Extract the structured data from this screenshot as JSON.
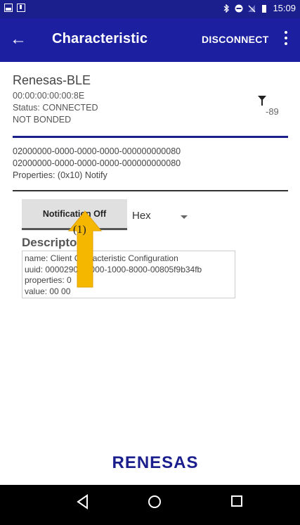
{
  "status_bar": {
    "time": "15:09",
    "icons": [
      "image-icon",
      "download-icon",
      "bluetooth-icon",
      "dnd-icon",
      "no-signal-icon",
      "battery-icon"
    ]
  },
  "app_bar": {
    "back_icon": "arrow-left-icon",
    "title": "Characteristic",
    "disconnect_label": "DISCONNECT",
    "more_icon": "more-vert-icon",
    "color": "#1b1fa0"
  },
  "device": {
    "name": "Renesas-BLE",
    "address": "00:00:00:00:00:8E",
    "status": "Status:  CONNECTED",
    "bond": "NOT BONDED",
    "rssi": "-89",
    "rssi_icon": "antenna-icon"
  },
  "characteristic": {
    "service_uuid": "02000000-0000-0000-0000-000000000080",
    "char_uuid": "02000000-0000-0000-0000-000000000080",
    "properties": "Properties: (0x10) Notify"
  },
  "controls": {
    "notification_label": "Notification Off",
    "format_value": "Hex"
  },
  "descriptors": {
    "title": "Descriptors",
    "name": "name: Client Characteristic Configuration",
    "uuid": "uuid: 00002902-0000-1000-8000-00805f9b34fb",
    "properties": "properties: 0",
    "value": "value: 00 00"
  },
  "annotation": {
    "label": "(1)",
    "arrow_color": "#f6b700"
  },
  "logo": {
    "text": "RENESAS",
    "color": "#1b1f8e"
  },
  "nav_bar": {
    "back_icon": "nav-back-icon",
    "home_icon": "nav-home-icon",
    "recents_icon": "nav-recents-icon"
  }
}
